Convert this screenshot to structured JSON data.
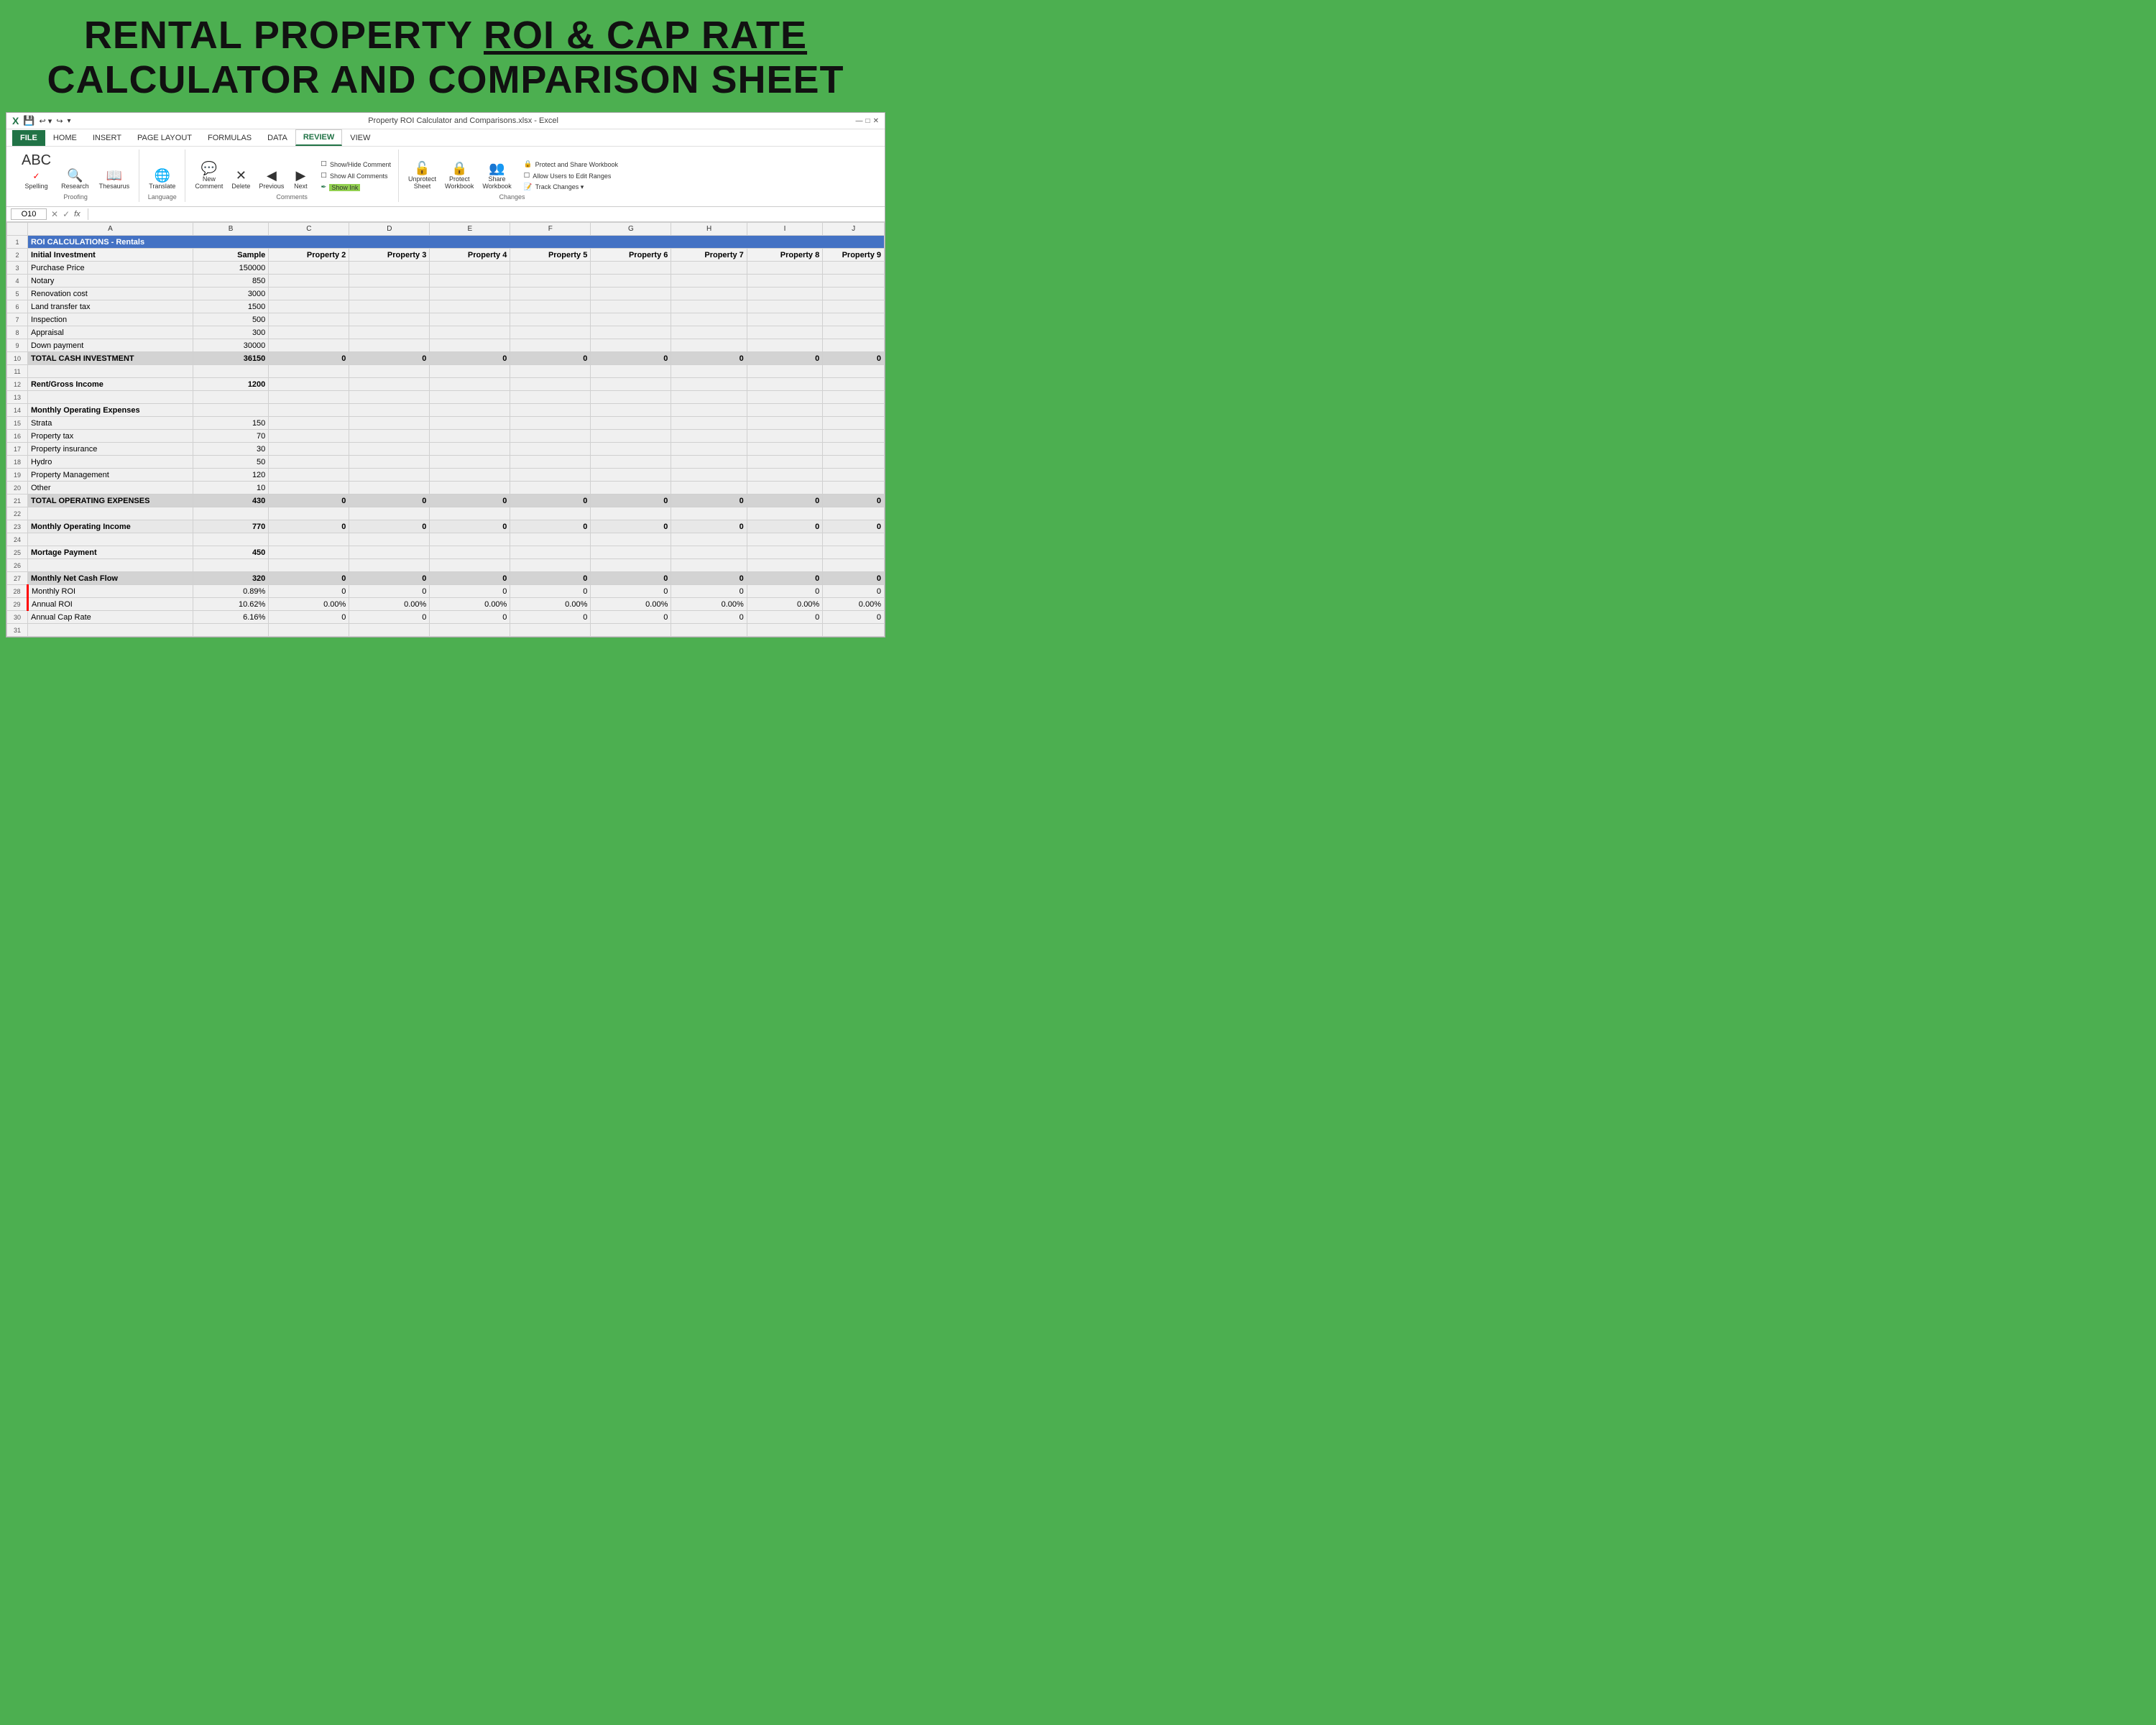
{
  "header": {
    "line1": "RENTAL PROPERTY ROI & CAP RATE",
    "line1_plain": "RENTAL PROPERTY ",
    "line1_underlined": "ROI & CAP RATE",
    "line2": "CALCULATOR AND COMPARISON SHEET"
  },
  "titlebar": {
    "filename": "Property ROI Calculator and Comparisons.xlsx - Excel",
    "icon": "X",
    "controls": [
      "↩",
      "↪",
      "-"
    ]
  },
  "ribbon": {
    "tabs": [
      "FILE",
      "HOME",
      "INSERT",
      "PAGE LAYOUT",
      "FORMULAS",
      "DATA",
      "REVIEW",
      "VIEW"
    ],
    "active_tab": "REVIEW",
    "groups": {
      "proofing": {
        "label": "Proofing",
        "buttons": [
          {
            "label": "Spelling",
            "icon": "ABC✓"
          },
          {
            "label": "Research",
            "icon": "🔍"
          },
          {
            "label": "Thesaurus",
            "icon": "📖"
          }
        ]
      },
      "language": {
        "label": "Language",
        "buttons": [
          {
            "label": "Translate",
            "icon": "🌐"
          }
        ]
      },
      "comments": {
        "label": "Comments",
        "buttons_left": [
          {
            "label": "New\nComment",
            "icon": "💬"
          },
          {
            "label": "Delete",
            "icon": "✕"
          },
          {
            "label": "Previous",
            "icon": "◀"
          },
          {
            "label": "Next",
            "icon": "▶"
          }
        ],
        "buttons_right": [
          {
            "label": "Show/Hide Comment",
            "icon": "☐"
          },
          {
            "label": "Show All Comments",
            "icon": "☐"
          },
          {
            "label": "Show Ink",
            "icon": "✒"
          }
        ]
      },
      "changes": {
        "label": "Changes",
        "left_buttons": [
          {
            "label": "Unprotect\nSheet",
            "icon": "🔓"
          },
          {
            "label": "Protect\nWorkbook",
            "icon": "🔒"
          },
          {
            "label": "Share\nWorkbook",
            "icon": "👥"
          }
        ],
        "right_items": [
          {
            "label": "Protect and Share Workbook",
            "icon": "🔒"
          },
          {
            "label": "Allow Users to Edit Ranges",
            "icon": "☐"
          },
          {
            "label": "Track Changes ▾",
            "icon": "📝"
          }
        ]
      }
    }
  },
  "formulabar": {
    "cell_ref": "O10",
    "formula": ""
  },
  "columns": [
    "",
    "A",
    "B",
    "C",
    "D",
    "E",
    "F",
    "G",
    "H",
    "I",
    "J"
  ],
  "rows": [
    {
      "num": "1",
      "a": "ROI CALCULATIONS - Rentals",
      "b": "",
      "c": "",
      "d": "",
      "e": "",
      "f": "",
      "g": "",
      "h": "",
      "i": "",
      "j": "",
      "style": "title"
    },
    {
      "num": "2",
      "a": "Initial Investment",
      "b": "Sample",
      "c": "Property 2",
      "d": "Property 3",
      "e": "Property 4",
      "f": "Property 5",
      "g": "Property 6",
      "h": "Property 7",
      "i": "Property 8",
      "j": "Property 9",
      "style": "header"
    },
    {
      "num": "3",
      "a": "Purchase Price",
      "b": "150000",
      "c": "",
      "d": "",
      "e": "",
      "f": "",
      "g": "",
      "h": "",
      "i": "",
      "j": ""
    },
    {
      "num": "4",
      "a": "Notary",
      "b": "850",
      "c": "",
      "d": "",
      "e": "",
      "f": "",
      "g": "",
      "h": "",
      "i": "",
      "j": ""
    },
    {
      "num": "5",
      "a": "Renovation cost",
      "b": "3000",
      "c": "",
      "d": "",
      "e": "",
      "f": "",
      "g": "",
      "h": "",
      "i": "",
      "j": ""
    },
    {
      "num": "6",
      "a": "Land transfer tax",
      "b": "1500",
      "c": "",
      "d": "",
      "e": "",
      "f": "",
      "g": "",
      "h": "",
      "i": "",
      "j": ""
    },
    {
      "num": "7",
      "a": "Inspection",
      "b": "500",
      "c": "",
      "d": "",
      "e": "",
      "f": "",
      "g": "",
      "h": "",
      "i": "",
      "j": ""
    },
    {
      "num": "8",
      "a": "Appraisal",
      "b": "300",
      "c": "",
      "d": "",
      "e": "",
      "f": "",
      "g": "",
      "h": "",
      "i": "",
      "j": ""
    },
    {
      "num": "9",
      "a": "Down payment",
      "b": "30000",
      "c": "",
      "d": "",
      "e": "",
      "f": "",
      "g": "",
      "h": "",
      "i": "",
      "j": ""
    },
    {
      "num": "10",
      "a": "TOTAL CASH INVESTMENT",
      "b": "36150",
      "c": "0",
      "d": "0",
      "e": "0",
      "f": "0",
      "g": "0",
      "h": "0",
      "i": "0",
      "j": "0",
      "style": "total"
    },
    {
      "num": "11",
      "a": "",
      "b": "",
      "c": "",
      "d": "",
      "e": "",
      "f": "",
      "g": "",
      "h": "",
      "i": "",
      "j": ""
    },
    {
      "num": "12",
      "a": "Rent/Gross Income",
      "b": "1200",
      "c": "",
      "d": "",
      "e": "",
      "f": "",
      "g": "",
      "h": "",
      "i": "",
      "j": "",
      "style": "section"
    },
    {
      "num": "13",
      "a": "",
      "b": "",
      "c": "",
      "d": "",
      "e": "",
      "f": "",
      "g": "",
      "h": "",
      "i": "",
      "j": ""
    },
    {
      "num": "14",
      "a": "Monthly Operating Expenses",
      "b": "",
      "c": "",
      "d": "",
      "e": "",
      "f": "",
      "g": "",
      "h": "",
      "i": "",
      "j": "",
      "style": "section"
    },
    {
      "num": "15",
      "a": "Strata",
      "b": "150",
      "c": "",
      "d": "",
      "e": "",
      "f": "",
      "g": "",
      "h": "",
      "i": "",
      "j": ""
    },
    {
      "num": "16",
      "a": "Property tax",
      "b": "70",
      "c": "",
      "d": "",
      "e": "",
      "f": "",
      "g": "",
      "h": "",
      "i": "",
      "j": ""
    },
    {
      "num": "17",
      "a": "Property insurance",
      "b": "30",
      "c": "",
      "d": "",
      "e": "",
      "f": "",
      "g": "",
      "h": "",
      "i": "",
      "j": ""
    },
    {
      "num": "18",
      "a": "Hydro",
      "b": "50",
      "c": "",
      "d": "",
      "e": "",
      "f": "",
      "g": "",
      "h": "",
      "i": "",
      "j": ""
    },
    {
      "num": "19",
      "a": "Property Management",
      "b": "120",
      "c": "",
      "d": "",
      "e": "",
      "f": "",
      "g": "",
      "h": "",
      "i": "",
      "j": ""
    },
    {
      "num": "20",
      "a": "Other",
      "b": "10",
      "c": "",
      "d": "",
      "e": "",
      "f": "",
      "g": "",
      "h": "",
      "i": "",
      "j": ""
    },
    {
      "num": "21",
      "a": "TOTAL OPERATING EXPENSES",
      "b": "430",
      "c": "0",
      "d": "0",
      "e": "0",
      "f": "0",
      "g": "0",
      "h": "0",
      "i": "0",
      "j": "0",
      "style": "total"
    },
    {
      "num": "22",
      "a": "",
      "b": "",
      "c": "",
      "d": "",
      "e": "",
      "f": "",
      "g": "",
      "h": "",
      "i": "",
      "j": ""
    },
    {
      "num": "23",
      "a": "Monthly Operating Income",
      "b": "770",
      "c": "0",
      "d": "0",
      "e": "0",
      "f": "0",
      "g": "0",
      "h": "0",
      "i": "0",
      "j": "0",
      "style": "section-total"
    },
    {
      "num": "24",
      "a": "",
      "b": "",
      "c": "",
      "d": "",
      "e": "",
      "f": "",
      "g": "",
      "h": "",
      "i": "",
      "j": ""
    },
    {
      "num": "25",
      "a": "Mortage Payment",
      "b": "450",
      "c": "",
      "d": "",
      "e": "",
      "f": "",
      "g": "",
      "h": "",
      "i": "",
      "j": "",
      "style": "section"
    },
    {
      "num": "26",
      "a": "",
      "b": "",
      "c": "",
      "d": "",
      "e": "",
      "f": "",
      "g": "",
      "h": "",
      "i": "",
      "j": ""
    },
    {
      "num": "27",
      "a": "Monthly Net Cash Flow",
      "b": "320",
      "c": "0",
      "d": "0",
      "e": "0",
      "f": "0",
      "g": "0",
      "h": "0",
      "i": "0",
      "j": "0",
      "style": "total"
    },
    {
      "num": "28",
      "a": "Monthly ROI",
      "b": "0.89%",
      "c": "0",
      "d": "0",
      "e": "0",
      "f": "0",
      "g": "0",
      "h": "0",
      "i": "0",
      "j": "0"
    },
    {
      "num": "29",
      "a": "Annual ROI",
      "b": "10.62%",
      "c": "0.00%",
      "d": "0.00%",
      "e": "0.00%",
      "f": "0.00%",
      "g": "0.00%",
      "h": "0.00%",
      "i": "0.00%",
      "j": "0.00%"
    },
    {
      "num": "30",
      "a": "Annual Cap Rate",
      "b": "6.16%",
      "c": "0",
      "d": "0",
      "e": "0",
      "f": "0",
      "g": "0",
      "h": "0",
      "i": "0",
      "j": "0"
    },
    {
      "num": "31",
      "a": "",
      "b": "",
      "c": "",
      "d": "",
      "e": "",
      "f": "",
      "g": "",
      "h": "",
      "i": "",
      "j": ""
    }
  ]
}
